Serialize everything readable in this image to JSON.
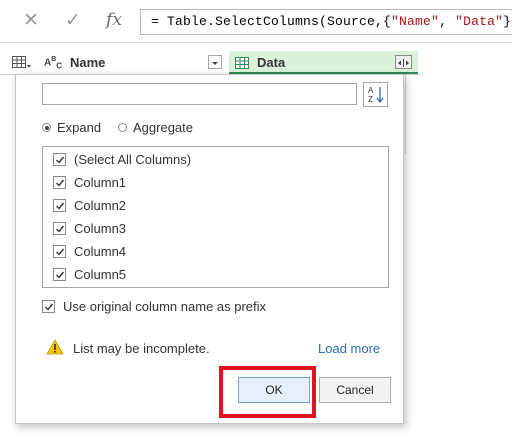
{
  "formula_bar": {
    "cancel_glyph": "✕",
    "commit_glyph": "✓",
    "fx_label": "fx",
    "formula_prefix": "= Table.SelectColumns(Source,{",
    "formula_str1": "\"Name\"",
    "formula_sep": ", ",
    "formula_str2": "\"Data\"",
    "formula_suffix": "})"
  },
  "grid": {
    "columns": [
      {
        "label": "Name",
        "type_icon": "text-type-icon"
      },
      {
        "label": "Data",
        "type_icon": "table-type-icon"
      }
    ]
  },
  "expand_dialog": {
    "search_value": "",
    "modes": {
      "expand": "Expand",
      "aggregate": "Aggregate",
      "selected": "expand"
    },
    "columns": [
      {
        "label": "(Select All Columns)",
        "checked": true
      },
      {
        "label": "Column1",
        "checked": true
      },
      {
        "label": "Column2",
        "checked": true
      },
      {
        "label": "Column3",
        "checked": true
      },
      {
        "label": "Column4",
        "checked": true
      },
      {
        "label": "Column5",
        "checked": true
      }
    ],
    "prefix_label": "Use original column name as prefix",
    "prefix_checked": true,
    "warning_text": "List may be incomplete.",
    "load_more": "Load more",
    "ok_label": "OK",
    "cancel_label": "Cancel"
  },
  "colors": {
    "selected_column_bg": "#d9f2d9",
    "selected_column_border": "#2e8b57",
    "highlight_border": "#e0141e",
    "link": "#2b6cb0",
    "warning_icon": "#f2c200"
  }
}
